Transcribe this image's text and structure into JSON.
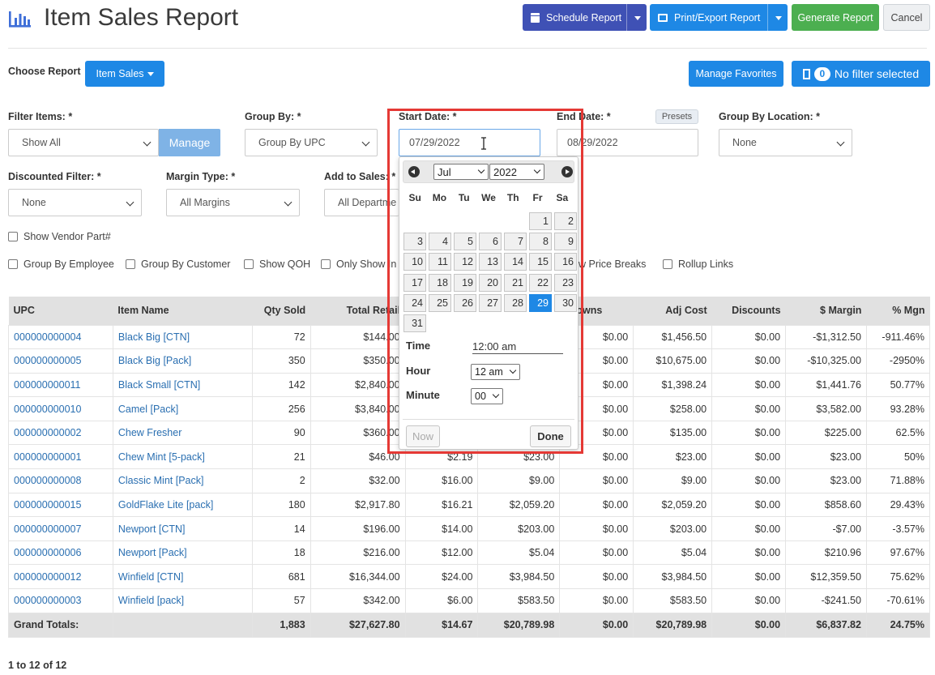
{
  "header": {
    "title": "Item Sales Report",
    "schedule_label": "Schedule Report",
    "print_label": "Print/Export Report",
    "generate_label": "Generate Report",
    "cancel_label": "Cancel"
  },
  "toolbar": {
    "choose_report_label": "Choose Report",
    "report_button_label": "Item Sales",
    "manage_favorites_label": "Manage Favorites",
    "filter_count": "0",
    "filter_status_label": "No filter selected"
  },
  "filters": {
    "filter_items": {
      "label": "Filter Items: *",
      "value": "Show All",
      "manage_label": "Manage"
    },
    "group_by": {
      "label": "Group By: *",
      "value": "Group By UPC"
    },
    "start_date": {
      "label": "Start Date: *",
      "value": "07/29/2022"
    },
    "end_date": {
      "label": "End Date: *",
      "value": "08/29/2022",
      "presets_label": "Presets"
    },
    "group_by_location": {
      "label": "Group By Location: *",
      "value": "None"
    },
    "discounted": {
      "label": "Discounted Filter: *",
      "value": "None"
    },
    "margin_type": {
      "label": "Margin Type: *",
      "value": "All Margins"
    },
    "add_to_sales": {
      "label": "Add to Sales: *",
      "value": "All Departme"
    }
  },
  "checkboxes": {
    "show_vendor_part": "Show Vendor Part#",
    "group_by_employee": "Group By Employee",
    "group_by_customer": "Group By Customer",
    "show_qoh": "Show QOH",
    "only_show_in": "Only Show In",
    "show_price_breaks": "w Price Breaks",
    "rollup_links": "Rollup Links"
  },
  "table": {
    "headers": {
      "upc": "UPC",
      "item_name": "Item Name",
      "qty_sold": "Qty Sold",
      "total_retail": "Total Retail",
      "markdowns": "ydowns",
      "adj_cost": "Adj Cost",
      "discounts": "Discounts",
      "margin": "$ Margin",
      "pct_margin": "% Mgn"
    },
    "rows": [
      {
        "upc": "000000000004",
        "name": "Black Big [CTN]",
        "qty": "72",
        "retail": "$144.00",
        "c5": "",
        "c6": "",
        "markdowns": "$0.00",
        "adj_cost": "$1,456.50",
        "discounts": "$0.00",
        "margin": "-$1,312.50",
        "pct": "-911.46%"
      },
      {
        "upc": "000000000005",
        "name": "Black Big [Pack]",
        "qty": "350",
        "retail": "$350.00",
        "c5": "",
        "c6": "",
        "markdowns": "$0.00",
        "adj_cost": "$10,675.00",
        "discounts": "$0.00",
        "margin": "-$10,325.00",
        "pct": "-2950%"
      },
      {
        "upc": "000000000011",
        "name": "Black Small [CTN]",
        "qty": "142",
        "retail": "$2,840.00",
        "c5": "",
        "c6": "",
        "markdowns": "$0.00",
        "adj_cost": "$1,398.24",
        "discounts": "$0.00",
        "margin": "$1,441.76",
        "pct": "50.77%"
      },
      {
        "upc": "000000000010",
        "name": "Camel [Pack]",
        "qty": "256",
        "retail": "$3,840.00",
        "c5": "",
        "c6": "",
        "markdowns": "$0.00",
        "adj_cost": "$258.00",
        "discounts": "$0.00",
        "margin": "$3,582.00",
        "pct": "93.28%"
      },
      {
        "upc": "000000000002",
        "name": "Chew Fresher",
        "qty": "90",
        "retail": "$360.00",
        "c5": "",
        "c6": "",
        "markdowns": "$0.00",
        "adj_cost": "$135.00",
        "discounts": "$0.00",
        "margin": "$225.00",
        "pct": "62.5%"
      },
      {
        "upc": "000000000001",
        "name": "Chew Mint [5-pack]",
        "qty": "21",
        "retail": "$46.00",
        "c5": "$2.19",
        "c6": "$23.00",
        "markdowns": "$0.00",
        "adj_cost": "$23.00",
        "discounts": "$0.00",
        "margin": "$23.00",
        "pct": "50%"
      },
      {
        "upc": "000000000008",
        "name": "Classic Mint [Pack]",
        "qty": "2",
        "retail": "$32.00",
        "c5": "$16.00",
        "c6": "$9.00",
        "markdowns": "$0.00",
        "adj_cost": "$9.00",
        "discounts": "$0.00",
        "margin": "$23.00",
        "pct": "71.88%"
      },
      {
        "upc": "000000000015",
        "name": "GoldFlake Lite [pack]",
        "qty": "180",
        "retail": "$2,917.80",
        "c5": "$16.21",
        "c6": "$2,059.20",
        "markdowns": "$0.00",
        "adj_cost": "$2,059.20",
        "discounts": "$0.00",
        "margin": "$858.60",
        "pct": "29.43%"
      },
      {
        "upc": "000000000007",
        "name": "Newport [CTN]",
        "qty": "14",
        "retail": "$196.00",
        "c5": "$14.00",
        "c6": "$203.00",
        "markdowns": "$0.00",
        "adj_cost": "$203.00",
        "discounts": "$0.00",
        "margin": "-$7.00",
        "pct": "-3.57%"
      },
      {
        "upc": "000000000006",
        "name": "Newport [Pack]",
        "qty": "18",
        "retail": "$216.00",
        "c5": "$12.00",
        "c6": "$5.04",
        "markdowns": "$0.00",
        "adj_cost": "$5.04",
        "discounts": "$0.00",
        "margin": "$210.96",
        "pct": "97.67%"
      },
      {
        "upc": "000000000012",
        "name": "Winfield [CTN]",
        "qty": "681",
        "retail": "$16,344.00",
        "c5": "$24.00",
        "c6": "$3,984.50",
        "markdowns": "$0.00",
        "adj_cost": "$3,984.50",
        "discounts": "$0.00",
        "margin": "$12,359.50",
        "pct": "75.62%"
      },
      {
        "upc": "000000000003",
        "name": "Winfield [pack]",
        "qty": "57",
        "retail": "$342.00",
        "c5": "$6.00",
        "c6": "$583.50",
        "markdowns": "$0.00",
        "adj_cost": "$583.50",
        "discounts": "$0.00",
        "margin": "-$241.50",
        "pct": "-70.61%"
      }
    ],
    "totals": {
      "label": "Grand Totals:",
      "qty": "1,883",
      "retail": "$27,627.80",
      "c5": "$14.67",
      "c6": "$20,789.98",
      "markdowns": "$0.00",
      "adj_cost": "$20,789.98",
      "discounts": "$0.00",
      "margin": "$6,837.82",
      "pct": "24.75%"
    }
  },
  "pagination": {
    "label": "1 to 12 of 12"
  },
  "datepicker": {
    "month": "Jul",
    "year": "2022",
    "weekdays": [
      "Su",
      "Mo",
      "Tu",
      "We",
      "Th",
      "Fr",
      "Sa"
    ],
    "days": [
      "1",
      "2",
      "3",
      "4",
      "5",
      "6",
      "7",
      "8",
      "9",
      "10",
      "11",
      "12",
      "13",
      "14",
      "15",
      "16",
      "17",
      "18",
      "19",
      "20",
      "21",
      "22",
      "23",
      "24",
      "25",
      "26",
      "27",
      "28",
      "29",
      "30",
      "31"
    ],
    "selected_day": "29",
    "first_weekday_index": 5,
    "time_label": "Time",
    "time_value": "12:00 am",
    "hour_label": "Hour",
    "hour_value": "12 am",
    "minute_label": "Minute",
    "minute_value": "00",
    "now_label": "Now",
    "done_label": "Done"
  },
  "colors": {
    "highlight": "#e53935",
    "accent": "#1e88e5",
    "indigo": "#3f51b5",
    "green": "#4caf50",
    "link": "#2a6fb1"
  }
}
